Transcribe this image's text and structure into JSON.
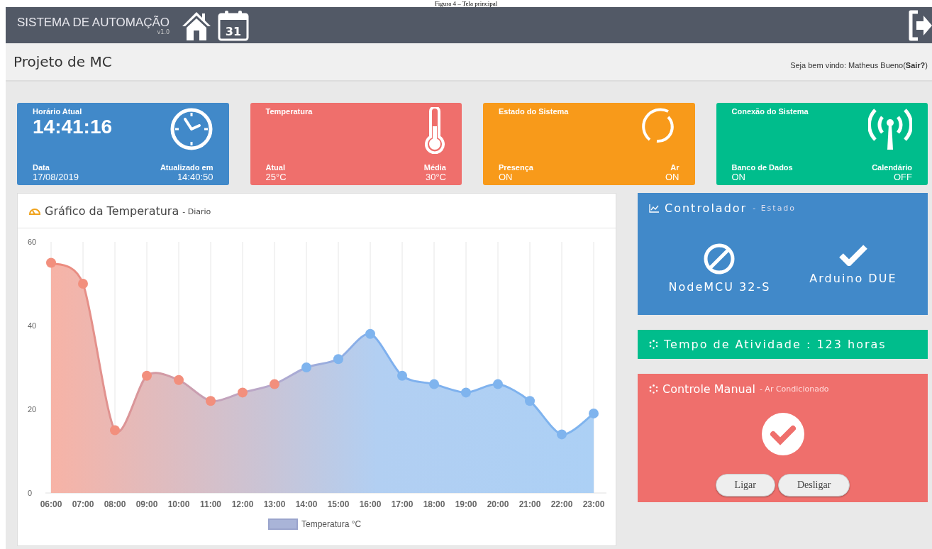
{
  "caption": "Figura 4 – Tela principal",
  "topbar": {
    "brand": "SISTEMA DE AUTOMAÇÃO",
    "version": "v1.0",
    "calendar_day": "31"
  },
  "header": {
    "title": "Projeto de MC",
    "welcome": "Seja bem vindo: Matheus Bueno(**Sair?**)"
  },
  "cards": [
    {
      "kind": "clock",
      "color": "#4189c9",
      "title": "Horário Atual",
      "big": "14:41:16",
      "left_label": "Data",
      "left_value": "17/08/2019",
      "right_label": "Atualizado em",
      "right_value": "14:40:50"
    },
    {
      "kind": "thermometer",
      "color": "#ef6f6c",
      "title": "Temperatura",
      "left_label": "Atual",
      "left_value": "25°C",
      "right_label": "Média",
      "right_value": "30°C"
    },
    {
      "kind": "spinner",
      "color": "#f89a1a",
      "title": "Estado do Sistema",
      "left_label": "Presença",
      "left_value": "ON",
      "right_label": "Ar",
      "right_value": "ON"
    },
    {
      "kind": "antenna",
      "color": "#00bd8c",
      "title": "Conexão do Sistema",
      "left_label": "Banco de Dados",
      "left_value": "ON",
      "right_label": "Calendário",
      "right_value": "OFF"
    }
  ],
  "chart_panel": {
    "title": "Gráfico da Temperatura",
    "subtitle": "- Diario",
    "chart_data": {
      "type": "area",
      "grid": true,
      "categories": [
        "06:00",
        "07:00",
        "08:00",
        "09:00",
        "10:00",
        "11:00",
        "12:00",
        "13:00",
        "14:00",
        "15:00",
        "16:00",
        "17:00",
        "18:00",
        "19:00",
        "20:00",
        "21:00",
        "22:00",
        "23:00"
      ],
      "ylim": [
        0,
        60
      ],
      "yticks": [
        0,
        20,
        40,
        60
      ],
      "series": [
        {
          "name": "Temperatura °C",
          "color": "#a9b4d8",
          "values": [
            55,
            50,
            15,
            28,
            27,
            22,
            24,
            26,
            30,
            32,
            38,
            28,
            26,
            24,
            26,
            22,
            14,
            19
          ]
        }
      ]
    }
  },
  "controller": {
    "title": "Controlador",
    "subtitle": "- Estado",
    "devices": [
      {
        "name": "NodeMCU 32-S",
        "ok": false
      },
      {
        "name": "Arduino DUE",
        "ok": true
      }
    ]
  },
  "uptime": {
    "text": "Tempo de Atividade : 123 horas"
  },
  "manual": {
    "title": "Controle Manual",
    "subtitle": "- Ar Condicionado",
    "on": true,
    "buttons": [
      "Ligar",
      "Desligar"
    ]
  }
}
